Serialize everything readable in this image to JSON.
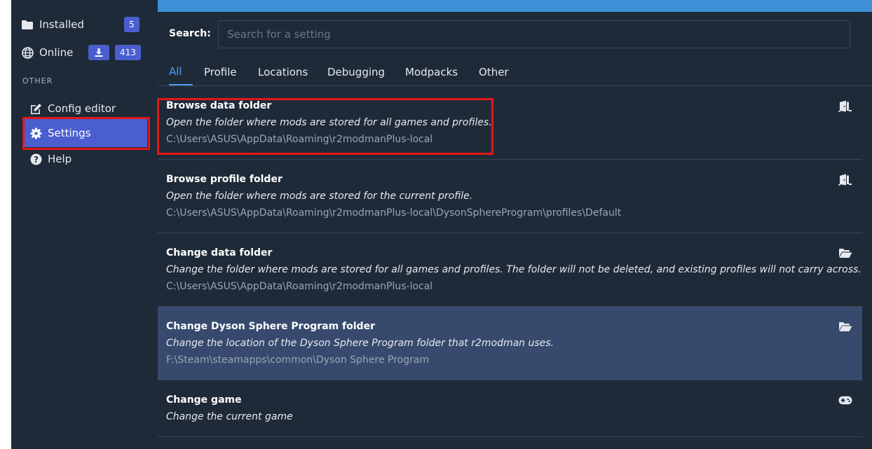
{
  "sidebar": {
    "installed": {
      "label": "Installed",
      "count": "5"
    },
    "online": {
      "label": "Online",
      "count": "413"
    },
    "section_other": "OTHER",
    "config_editor": "Config editor",
    "settings": "Settings",
    "help": "Help"
  },
  "search": {
    "label": "Search:",
    "placeholder": "Search for a setting"
  },
  "tabs": [
    "All",
    "Profile",
    "Locations",
    "Debugging",
    "Modpacks",
    "Other"
  ],
  "active_tab": "All",
  "settings": [
    {
      "title": "Browse data folder",
      "description": "Open the folder where mods are stored for all games and profiles.",
      "path": "C:\\Users\\ASUS\\AppData\\Roaming\\r2modmanPlus-local",
      "icon": "door-open-icon"
    },
    {
      "title": "Browse profile folder",
      "description": "Open the folder where mods are stored for the current profile.",
      "path": "C:\\Users\\ASUS\\AppData\\Roaming\\r2modmanPlus-local\\DysonSphereProgram\\profiles\\Default",
      "icon": "door-open-icon"
    },
    {
      "title": "Change data folder",
      "description": "Change the folder where mods are stored for all games and profiles. The folder will not be deleted, and existing profiles will not carry across.",
      "path": "C:\\Users\\ASUS\\AppData\\Roaming\\r2modmanPlus-local",
      "icon": "folder-open-icon"
    },
    {
      "title": "Change Dyson Sphere Program folder",
      "description": "Change the location of the Dyson Sphere Program folder that r2modman uses.",
      "path": "F:\\Steam\\steamapps\\common\\Dyson Sphere Program",
      "icon": "folder-open-icon"
    },
    {
      "title": "Change game",
      "description": "Change the current game",
      "path": "",
      "icon": "gamepad-icon"
    }
  ],
  "colors": {
    "background": "#1f2a38",
    "accent": "#4a5ecf",
    "topbar": "#3d8fd6",
    "highlight_row": "#374a6e",
    "annotation_red": "#e01818"
  }
}
